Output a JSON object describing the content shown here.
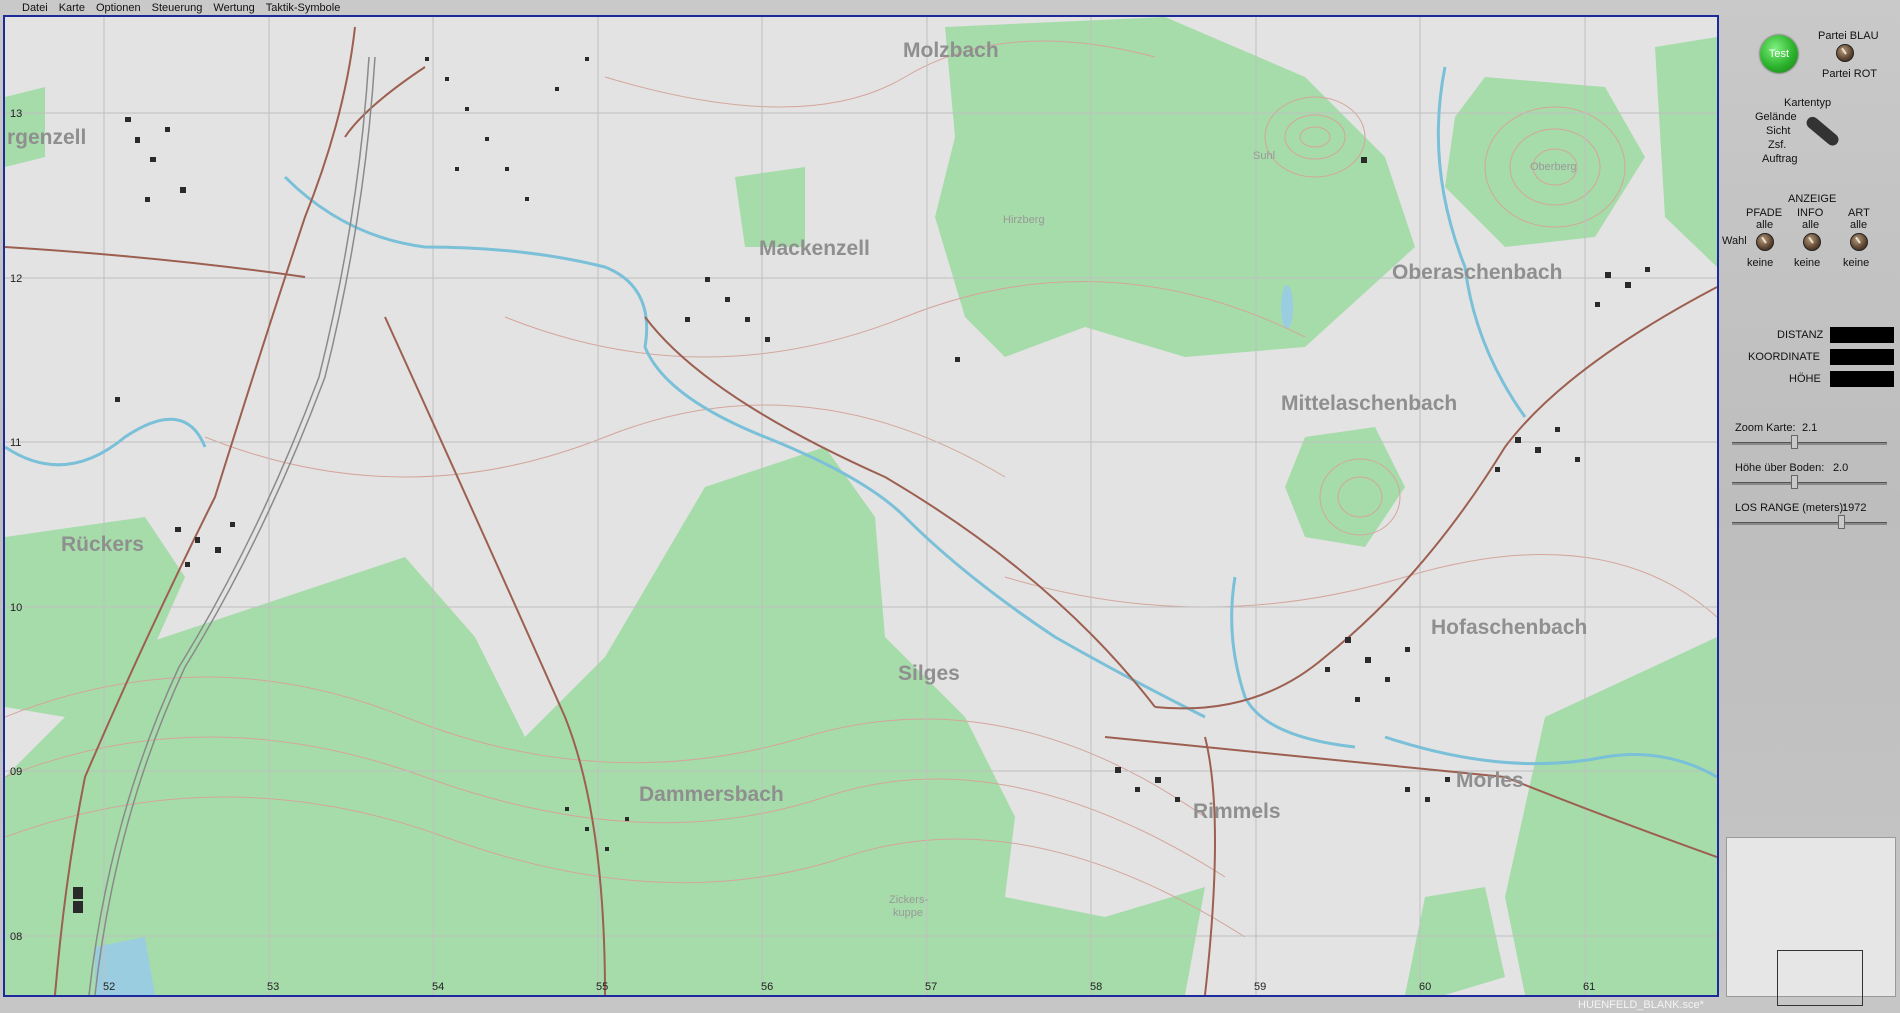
{
  "menu": [
    "Datei",
    "Karte",
    "Optionen",
    "Steuerung",
    "Wertung",
    "Taktik-Symbole"
  ],
  "map": {
    "towns": [
      {
        "name": "Molzbach"
      },
      {
        "name": "rgenzell"
      },
      {
        "name": "Mackenzell"
      },
      {
        "name": "Oberaschenbach"
      },
      {
        "name": "Mittelaschenbach"
      },
      {
        "name": "Rückers"
      },
      {
        "name": "Hofaschenbach"
      },
      {
        "name": "Silges"
      },
      {
        "name": "Dammersbach"
      },
      {
        "name": "Rimmels"
      },
      {
        "name": "Morles"
      }
    ],
    "features": [
      {
        "name": "Suhl"
      },
      {
        "name": "Oberberg"
      },
      {
        "name": "Hirzberg"
      },
      {
        "name": "Zickers-"
      },
      {
        "name": "kuppe"
      }
    ],
    "x_ticks": [
      "52",
      "53",
      "54",
      "55",
      "56",
      "57",
      "58",
      "59",
      "60",
      "61"
    ],
    "y_ticks": [
      "13",
      "12",
      "11",
      "10",
      "09",
      "08"
    ]
  },
  "panel": {
    "test_label": "Test",
    "partei_blau": "Partei BLAU",
    "partei_rot": "Partei ROT",
    "kartentyp_title": "Kartentyp",
    "kartentyp_options": [
      "Gelände",
      "Sicht",
      "Zsf.",
      "Auftrag"
    ],
    "anzeige_title": "ANZEIGE",
    "pfade": "PFADE",
    "info": "INFO",
    "art": "ART",
    "alle": "alle",
    "keine": "keine",
    "wahl": "Wahl",
    "distanz": "DISTANZ",
    "koordinate": "KOORDINATE",
    "hoehe": "HÖHE",
    "zoom_label": "Zoom Karte:",
    "zoom_value": "2.1",
    "zoom_level": 0.4,
    "hob_label": "Höhe über Boden:",
    "hob_value": "2.0",
    "hob_level": 0.4,
    "los_label": "LOS RANGE (meters):",
    "los_value": "1972",
    "los_level": 0.7
  },
  "footer": "HUENFELD_BLANK.sce*",
  "colors": {
    "frame": "#1d2a9b",
    "forest": "#a6dcaa",
    "water": "#7ac0d8",
    "road": "#9c5f50",
    "contour": "#d4a59c",
    "grid": "#bfbfbf",
    "town_label": "#8f8f8f"
  }
}
